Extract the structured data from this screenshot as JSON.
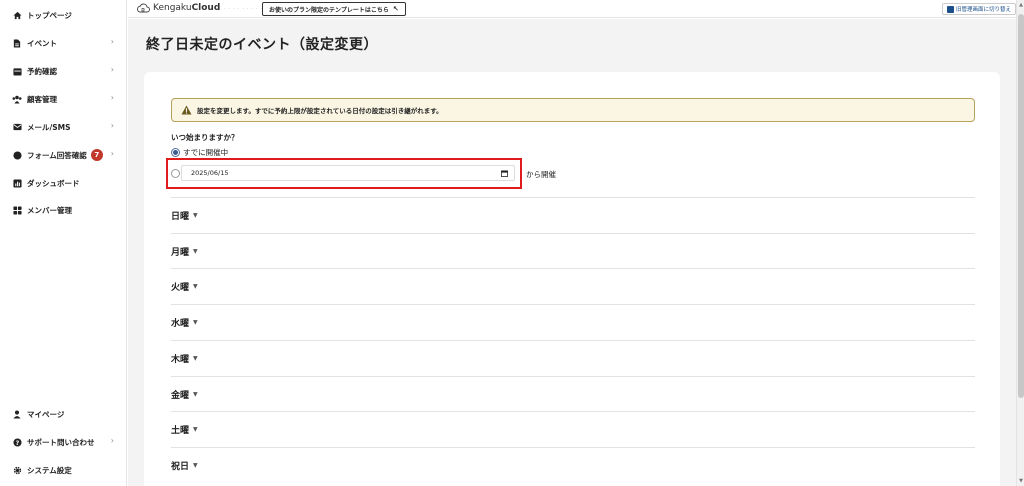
{
  "sidebar": {
    "items": [
      {
        "label": "トップページ",
        "icon": "home-icon",
        "chevron": ""
      },
      {
        "label": "イベント",
        "icon": "document-icon",
        "chevron": "›"
      },
      {
        "label": "予約確認",
        "icon": "calendar-icon",
        "chevron": "›"
      },
      {
        "label": "顧客管理",
        "icon": "users-icon",
        "chevron": "›"
      },
      {
        "label": "メール/SMS",
        "icon": "mail-icon",
        "chevron": "›"
      },
      {
        "label": "フォーム回答確認",
        "icon": "comment-icon",
        "chevron": "›",
        "badge": "7"
      },
      {
        "label": "ダッシュボード",
        "icon": "chart-icon",
        "chevron": ""
      },
      {
        "label": "メンバー管理",
        "icon": "grid-icon",
        "chevron": ""
      }
    ],
    "bottom_items": [
      {
        "label": "マイページ",
        "icon": "person-icon",
        "chevron": ""
      },
      {
        "label": "サポート問い合わせ",
        "icon": "help-icon",
        "chevron": "›"
      },
      {
        "label": "システム設定",
        "icon": "gear-icon",
        "chevron": ""
      }
    ]
  },
  "header": {
    "logo_prefix": "Kengaku",
    "logo_suffix": "Cloud",
    "plan_button": "お使いのプラン限定のテンプレートはこちら",
    "switch_button": "旧管理画面に切り替え"
  },
  "main": {
    "title": "終了日未定のイベント（設定変更）",
    "alert": "設定を変更します。すでに予約上限が設定されている日付の設定は引き継がれます。",
    "question": "いつ始まりますか？",
    "radio_already": "すでに開催中",
    "date_value": "2025/06/15",
    "date_suffix": "から開催",
    "days": [
      "日曜",
      "月曜",
      "火曜",
      "水曜",
      "木曜",
      "金曜",
      "土曜",
      "祝日"
    ]
  },
  "colors": {
    "highlight": "#e01b1b",
    "alert_bg": "#fbf6e3",
    "alert_border": "#b8a15a",
    "badge": "#c0392b",
    "radio_selected": "#3b5b8f"
  }
}
